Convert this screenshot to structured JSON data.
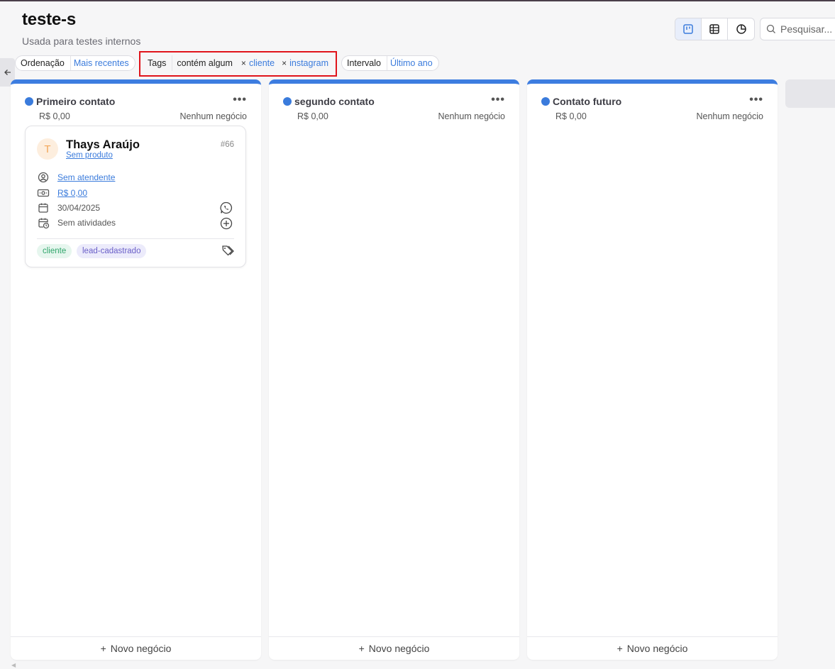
{
  "page": {
    "title": "teste-s",
    "subtitle": "Usada para testes internos"
  },
  "views": {
    "kanban_icon": "kanban-icon",
    "table_icon": "table-icon",
    "chart_icon": "pie-chart-icon"
  },
  "search": {
    "placeholder": "Pesquisar..."
  },
  "filters": {
    "sort": {
      "label": "Ordenação",
      "value": "Mais recentes"
    },
    "tags": {
      "label": "Tags",
      "operator": "contém algum",
      "values": [
        "cliente",
        "instagram"
      ],
      "remove_symbol": "×"
    },
    "range": {
      "label": "Intervalo",
      "value": "Último ano"
    }
  },
  "columns": [
    {
      "title": "Primeiro contato",
      "total": "R$ 0,00",
      "count": "Nenhum negócio",
      "footer": "Novo negócio",
      "more": "•••",
      "accent": "#3d7de0"
    },
    {
      "title": "segundo contato",
      "total": "R$ 0,00",
      "count": "Nenhum negócio",
      "footer": "Novo negócio",
      "more": "•••",
      "accent": "#3d7de0"
    },
    {
      "title": "Contato futuro",
      "total": "R$ 0,00",
      "count": "Nenhum negócio",
      "footer": "Novo negócio",
      "more": "•••",
      "accent": "#3d7de0"
    }
  ],
  "card": {
    "avatar": "T",
    "name": "Thays Araújo",
    "product": "Sem produto",
    "id": "#66",
    "agent": "Sem atendente",
    "value": "R$ 0,00",
    "date": "30/04/2025",
    "activities": "Sem atividades",
    "tags": [
      "cliente",
      "lead-cadastrado"
    ]
  },
  "footer_plus": "+",
  "colors": {
    "accent": "#3a7bdc",
    "highlight": "#e0141b",
    "tag_green": "#2fa56a",
    "tag_purple": "#6a5fc8"
  }
}
